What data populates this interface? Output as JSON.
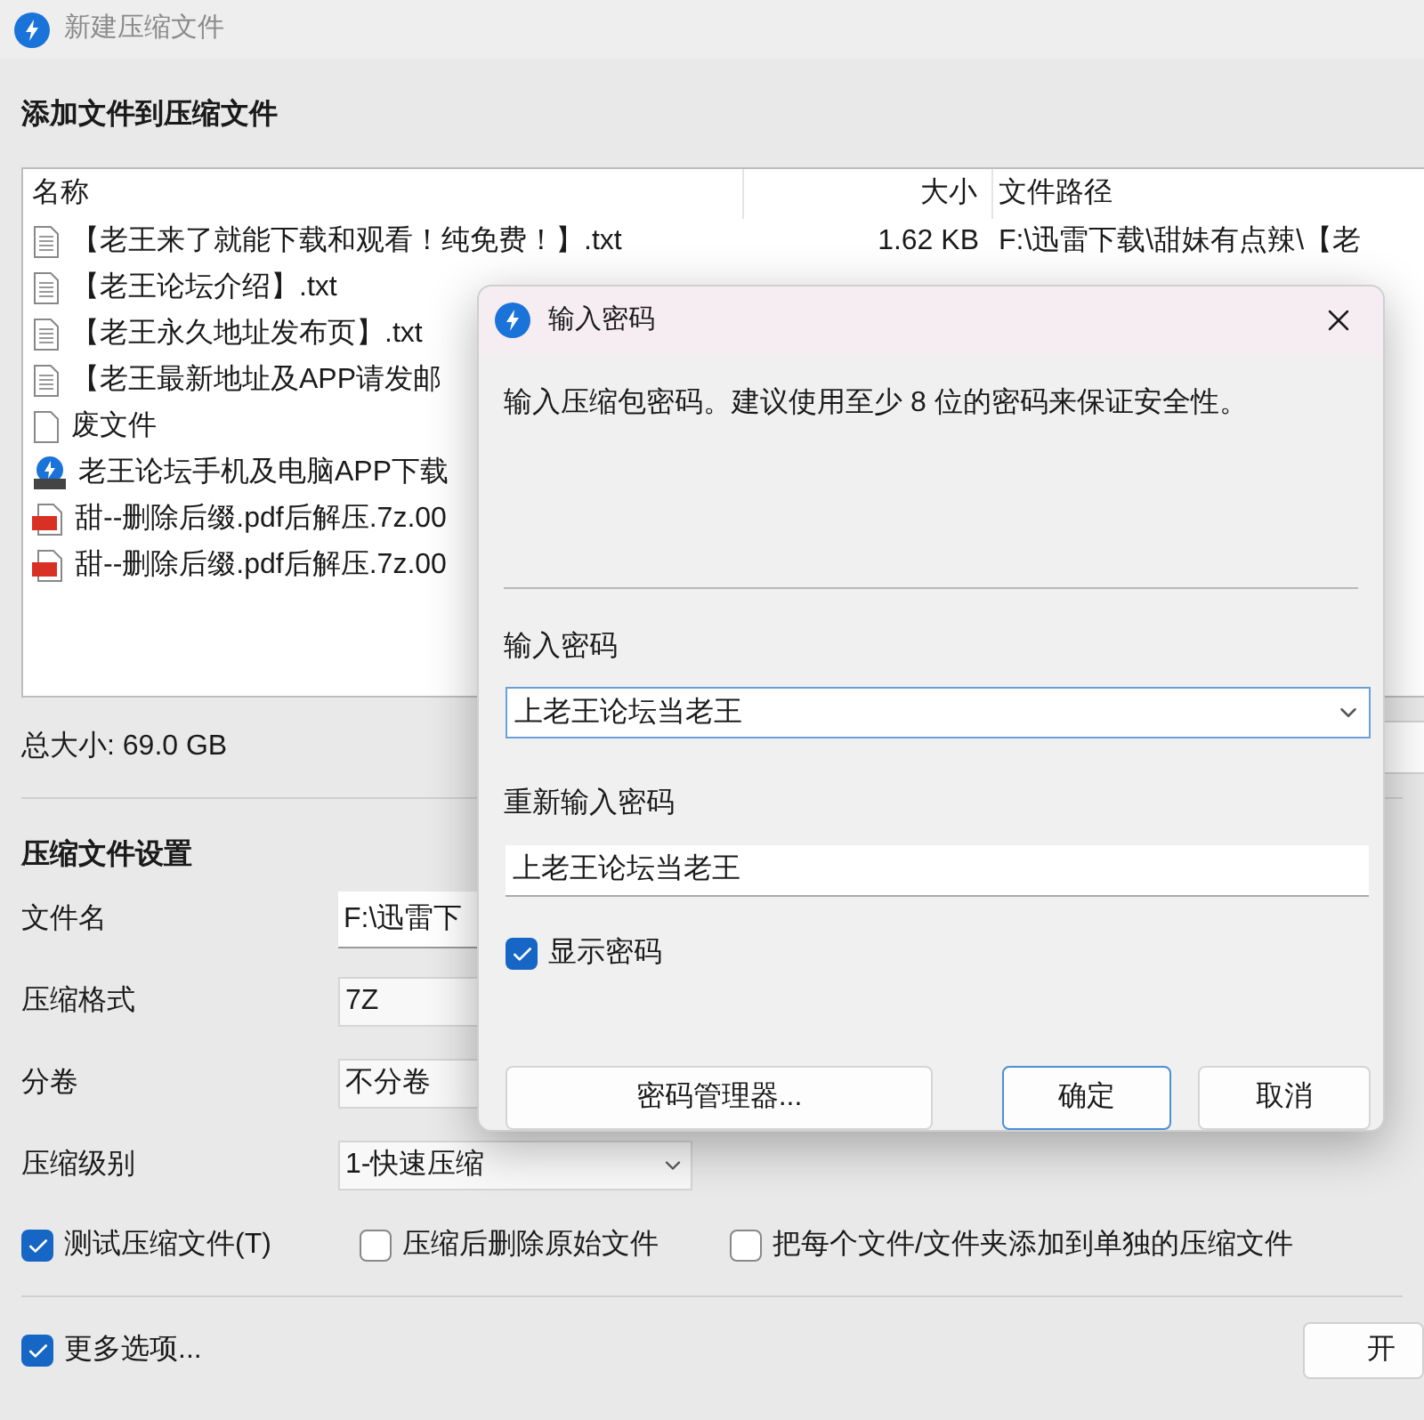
{
  "window": {
    "title": "新建压缩文件"
  },
  "heading": "添加文件到压缩文件",
  "file_list": {
    "columns": [
      "名称",
      "大小",
      "文件路径"
    ],
    "rows": [
      {
        "kind": "text",
        "name": "【老王来了就能下载和观看！纯免费！】.txt",
        "size": "1.62 KB",
        "path": "F:\\迅雷下载\\甜妹有点辣\\【老"
      },
      {
        "kind": "text",
        "name": "【老王论坛介绍】.txt"
      },
      {
        "kind": "text",
        "name": "【老王永久地址发布页】.txt"
      },
      {
        "kind": "text",
        "name": "【老王最新地址及APP请发邮"
      },
      {
        "kind": "blank",
        "name": "废文件"
      },
      {
        "kind": "zip",
        "name": "老王论坛手机及电脑APP下载"
      },
      {
        "kind": "pdf",
        "name": "甜--删除后缀.pdf后解压.7z.00"
      },
      {
        "kind": "pdf",
        "name": "甜--删除后缀.pdf后解压.7z.00"
      }
    ]
  },
  "total_size": "总大小: 69.0 GB",
  "settings": {
    "title": "压缩文件设置",
    "fields": [
      {
        "kind": "text",
        "label": "文件名",
        "value": "F:\\迅雷下"
      },
      {
        "kind": "dropdown",
        "label": "压缩格式",
        "value": "7Z"
      },
      {
        "kind": "dropdown",
        "label": "分卷",
        "value": "不分卷"
      },
      {
        "kind": "dropdown",
        "label": "压缩级别",
        "value": "1-快速压缩"
      }
    ]
  },
  "options": [
    {
      "label": "测试压缩文件(T)",
      "checked": true
    },
    {
      "label": "压缩后删除原始文件",
      "checked": false
    },
    {
      "label": "把每个文件/文件夹添加到单独的压缩文件",
      "checked": false
    }
  ],
  "more_options": {
    "label": "更多选项...",
    "checked": true
  },
  "start_button": "开",
  "dialog": {
    "title": "输入密码",
    "message": "输入压缩包密码。建议使用至少 8 位的密码来保证安全性。",
    "password_label": "输入密码",
    "password_value": "上老王论坛当老王",
    "confirm_label": "重新输入密码",
    "confirm_value": "上老王论坛当老王",
    "show_password": {
      "label": "显示密码",
      "checked": true
    },
    "buttons": [
      {
        "kind": "manager",
        "label": "密码管理器..."
      },
      {
        "kind": "default",
        "label": "确定"
      },
      {
        "kind": "normal",
        "label": "取消"
      }
    ]
  }
}
